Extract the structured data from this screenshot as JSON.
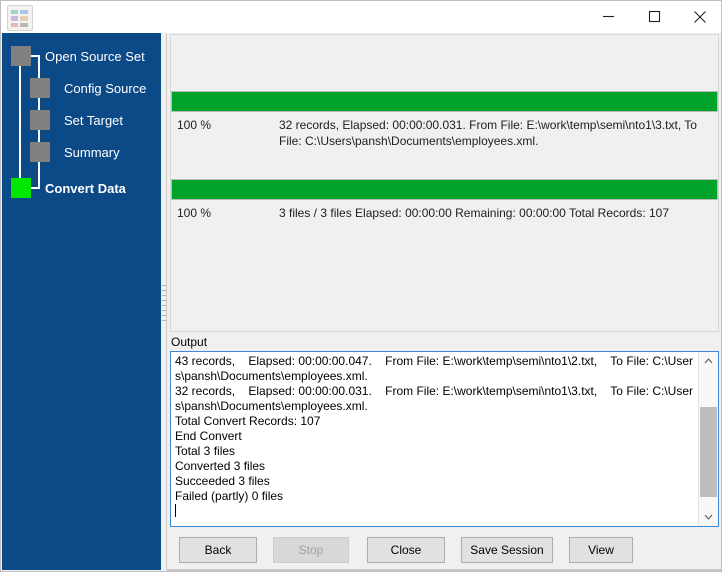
{
  "window": {
    "title": "",
    "icon": "table-grid-icon",
    "controls": {
      "minimize": "minimize-icon",
      "maximize": "maximize-icon",
      "close": "close-icon"
    }
  },
  "theme": {
    "sidebar_bg": "#0b4a87",
    "progress_green": "#00a32a",
    "current_step_marker": "#00e800",
    "step_marker": "#808080",
    "focus_border": "#3b8ad9"
  },
  "sidebar": {
    "steps": [
      {
        "label": "Open Source Set",
        "current": false
      },
      {
        "label": "Config Source",
        "current": false
      },
      {
        "label": "Set Target",
        "current": false
      },
      {
        "label": "Summary",
        "current": false
      },
      {
        "label": "Convert Data",
        "current": true
      }
    ]
  },
  "progress": {
    "file": {
      "percent_label": "100 %",
      "percent_value": 100,
      "detail": "32 records,    Elapsed: 00:00:00.031.    From File: E:\\work\\temp\\semi\\nto1\\3.txt,    To File: C:\\Users\\pansh\\Documents\\employees.xml."
    },
    "overall": {
      "percent_label": "100 %",
      "percent_value": 100,
      "detail": "3 files / 3 files    Elapsed: 00:00:00    Remaining: 00:00:00    Total Records: 107"
    }
  },
  "output": {
    "label": "Output",
    "text": "43 records,    Elapsed: 00:00:00.047.    From File: E:\\work\\temp\\semi\\nto1\\2.txt,    To File: C:\\Users\\pansh\\Documents\\employees.xml.\n32 records,    Elapsed: 00:00:00.031.    From File: E:\\work\\temp\\semi\\nto1\\3.txt,    To File: C:\\Users\\pansh\\Documents\\employees.xml.\nTotal Convert Records: 107\nEnd Convert\nTotal 3 files\nConverted 3 files\nSucceeded 3 files\nFailed (partly) 0 files\n",
    "scrollbar": {
      "up_arrow": "chevron-up-icon",
      "down_arrow": "chevron-down-icon"
    }
  },
  "buttons": {
    "back": {
      "label": "Back",
      "disabled": false
    },
    "stop": {
      "label": "Stop",
      "disabled": true
    },
    "close": {
      "label": "Close",
      "disabled": false
    },
    "save_session": {
      "label": "Save Session",
      "disabled": false
    },
    "view": {
      "label": "View",
      "disabled": false
    }
  }
}
